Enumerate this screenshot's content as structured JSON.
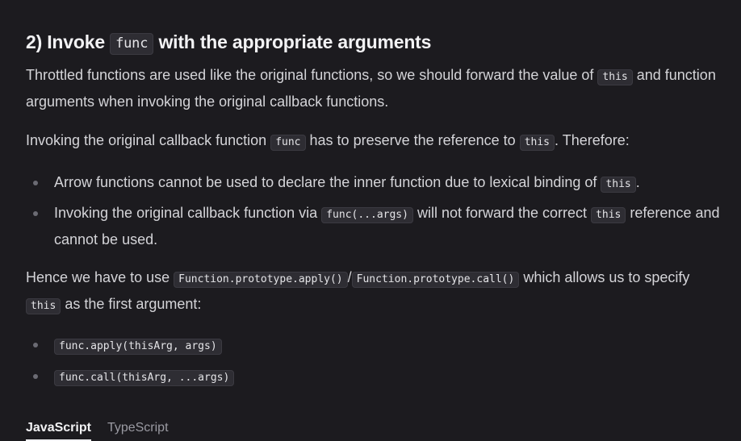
{
  "heading": {
    "prefix": "2) Invoke",
    "code": "func",
    "suffix": "with the appropriate arguments"
  },
  "para1": {
    "t1": "Throttled functions are used like the original functions, so we should forward the value of",
    "c1": "this",
    "t2": "and function arguments when invoking the original callback functions."
  },
  "para2": {
    "t1": "Invoking the original callback function",
    "c1": "func",
    "t2": "has to preserve the reference to",
    "c2": "this",
    "t3": ". Therefore:"
  },
  "list1": {
    "item1": {
      "t1": "Arrow functions cannot be used to declare the inner function due to lexical binding of",
      "c1": "this",
      "t2": "."
    },
    "item2": {
      "t1": "Invoking the original callback function via",
      "c1": "func(...args)",
      "t2": "will not forward the correct",
      "c2": "this",
      "t3": "reference and cannot be used."
    }
  },
  "para3": {
    "t1": "Hence we have to use",
    "c1": "Function.prototype.apply()",
    "sep": "/",
    "c2": "Function.prototype.call()",
    "t2": "which allows us to specify",
    "c3": "this",
    "t3": "as the first argument:"
  },
  "list2": {
    "item1": "func.apply(thisArg, args)",
    "item2": "func.call(thisArg, ...args)"
  },
  "tabs": [
    {
      "label": "JavaScript",
      "active": true
    },
    {
      "label": "TypeScript",
      "active": false
    }
  ]
}
